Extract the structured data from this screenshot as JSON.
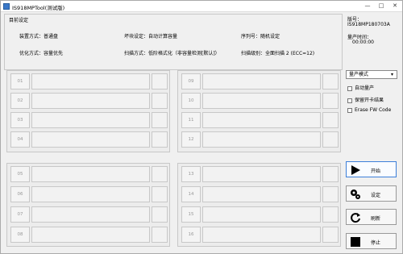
{
  "window": {
    "title": "IS918MPTool(测试版)"
  },
  "config": {
    "header": "目前设定",
    "rows": [
      {
        "col1": "装置方式：普通盘",
        "col2": "坏块设定：自动计算容量",
        "col3": "序列号：随机设定"
      },
      {
        "col1": "优化方式：容量优先",
        "col2": "扫描方式：低阶格式化（非容量检测[默认]）",
        "col3": "扫描级别：全面扫描 2 (ECC=12)"
      }
    ]
  },
  "info": {
    "version_label": "版号：",
    "version_value": "IS918MP180703A",
    "time_label": "量产时间：",
    "time_value": "00:00:00"
  },
  "slots_left_top": [
    "01",
    "02",
    "03",
    "04"
  ],
  "slots_right_top": [
    "09",
    "10",
    "11",
    "12"
  ],
  "slots_left_bottom": [
    "05",
    "06",
    "07",
    "08"
  ],
  "slots_right_bottom": [
    "13",
    "14",
    "15",
    "16"
  ],
  "mode": {
    "selected": "量产模式"
  },
  "options": [
    "自动量产",
    "保留开卡结果",
    "Erase FW Code"
  ],
  "buttons": {
    "start": "开始",
    "settings": "设定",
    "refresh": "刷新",
    "stop": "停止"
  }
}
